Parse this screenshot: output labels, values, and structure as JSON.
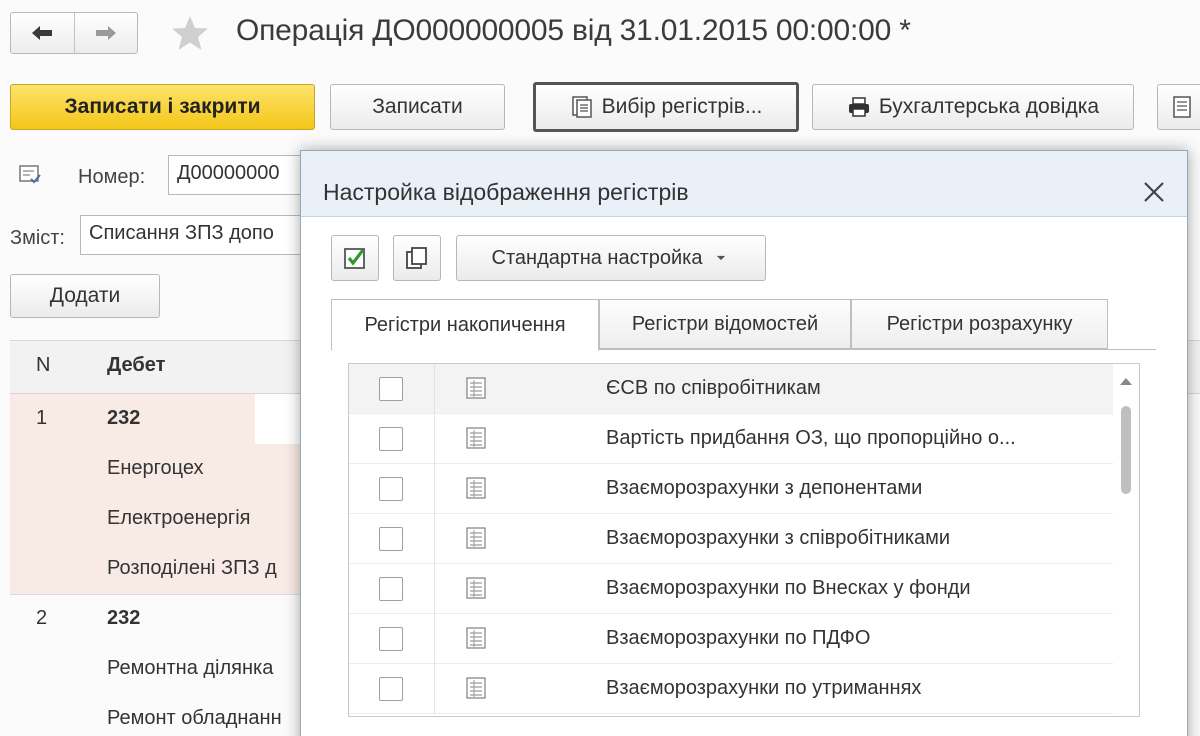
{
  "window": {
    "title": "Операція ДО000000005 від 31.01.2015 00:00:00 *"
  },
  "toolbar": {
    "save_close_label": "Записати і закрити",
    "save_label": "Записати",
    "registers_label": "Вибір регістрів...",
    "reference_label": "Бухгалтерська довідка"
  },
  "form": {
    "number_label": "Номер:",
    "number_value": "Д00000000",
    "content_label": "Зміст:",
    "content_value": "Списання ЗПЗ допо",
    "add_label": "Додати"
  },
  "table": {
    "columns": [
      "N",
      "Дебет"
    ],
    "rows": [
      {
        "n": "1",
        "account": "232",
        "details": [
          "Енергоцех",
          "Електроенергія",
          "Розподілені ЗПЗ д"
        ]
      },
      {
        "n": "2",
        "account": "232",
        "details": [
          "Ремонтна ділянка",
          "Ремонт обладнанн"
        ]
      }
    ]
  },
  "modal": {
    "title": "Настройка відображення регістрів",
    "standard_label": "Стандартна настройка",
    "tabs": [
      {
        "label": "Регістри накопичення",
        "active": true
      },
      {
        "label": "Регістри відомостей",
        "active": false
      },
      {
        "label": "Регістри розрахунку",
        "active": false
      }
    ],
    "registers": [
      {
        "name": "ЄСВ по співробітникам",
        "checked": false
      },
      {
        "name": "Вартість придбання ОЗ, що пропорційно о...",
        "checked": false
      },
      {
        "name": "Взаєморозрахунки з депонентами",
        "checked": false
      },
      {
        "name": "Взаєморозрахунки з співробітниками",
        "checked": false
      },
      {
        "name": "Взаєморозрахунки по Внесках у фонди",
        "checked": false
      },
      {
        "name": "Взаєморозрахунки по ПДФО",
        "checked": false
      },
      {
        "name": "Взаєморозрахунки по утриманнях",
        "checked": false
      }
    ]
  },
  "colors": {
    "primary_button": "#f4c619",
    "selected_row": "#f8ebe6",
    "modal_header": "#e9f0f8",
    "check_green": "#2e9a2e"
  },
  "icons": [
    "back-arrow-icon",
    "forward-arrow-icon",
    "favorite-star-icon",
    "register-list-icon",
    "printer-icon",
    "report-icon",
    "document-posted-icon",
    "close-icon",
    "check-all-icon",
    "copy-icon",
    "dropdown-arrow-icon",
    "register-icon"
  ]
}
